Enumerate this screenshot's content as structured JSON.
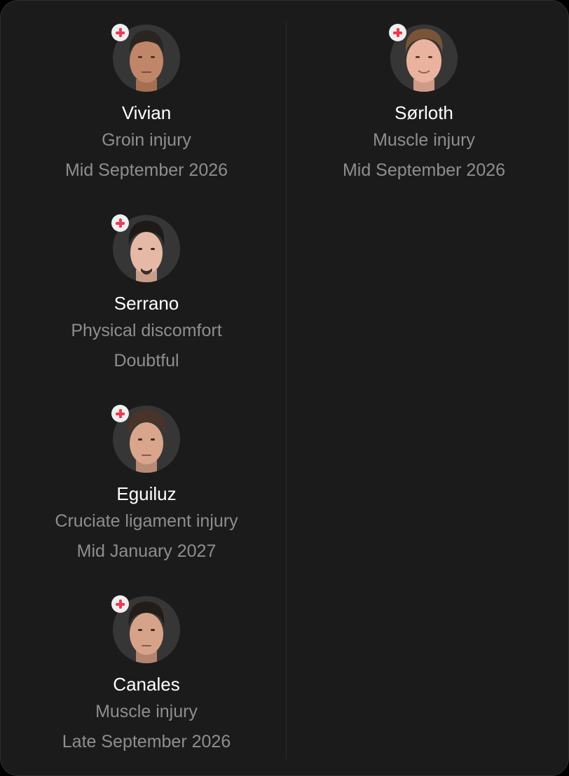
{
  "colors": {
    "card_background": "#1b1b1b",
    "name_text": "#ffffff",
    "secondary_text": "#8e8e8e",
    "injury_badge_cross": "#ee3a4f",
    "injury_badge_background": "#efefef"
  },
  "left_column": [
    {
      "name": "Vivian",
      "reason": "Groin injury",
      "expected_return": "Mid September 2026",
      "badge_icon": "injury-cross-icon"
    },
    {
      "name": "Serrano",
      "reason": "Physical discomfort",
      "expected_return": "Doubtful",
      "badge_icon": "injury-cross-icon"
    },
    {
      "name": "Eguiluz",
      "reason": "Cruciate ligament injury",
      "expected_return": "Mid January 2027",
      "badge_icon": "injury-cross-icon"
    },
    {
      "name": "Canales",
      "reason": "Muscle injury",
      "expected_return": "Late September 2026",
      "badge_icon": "injury-cross-icon"
    }
  ],
  "right_column": [
    {
      "name": "Sørloth",
      "reason": "Muscle injury",
      "expected_return": "Mid September 2026",
      "badge_icon": "injury-cross-icon"
    }
  ]
}
